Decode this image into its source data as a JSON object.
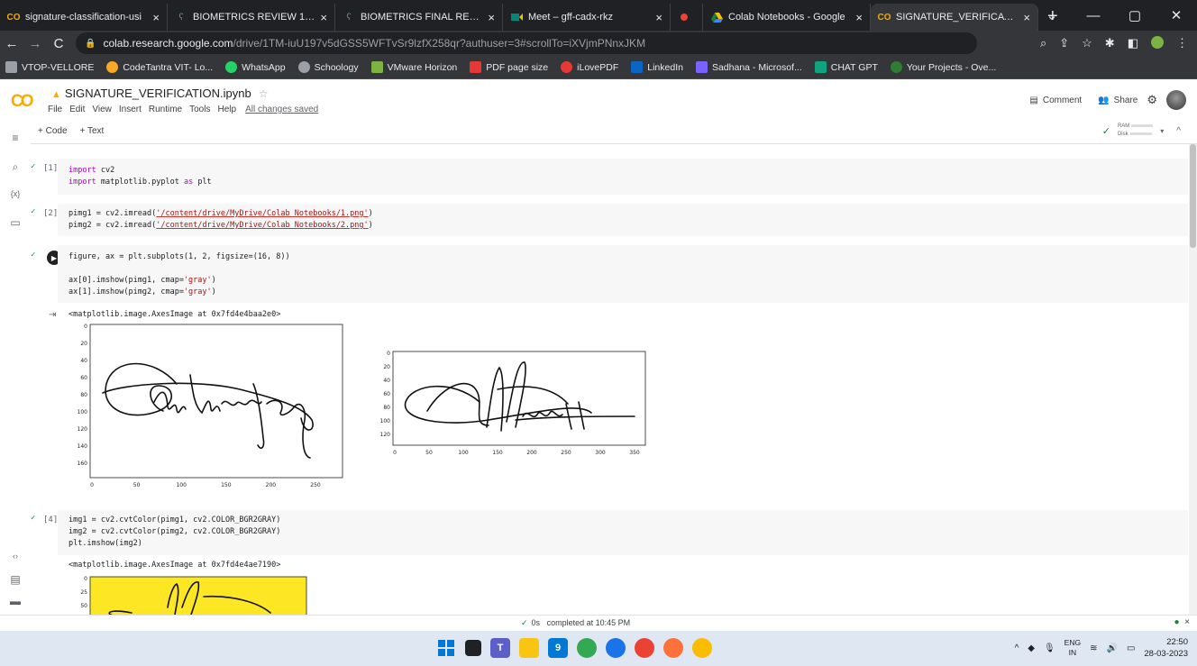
{
  "browser": {
    "tabs": [
      {
        "title": "signature-classification-usi",
        "icon": "colab-icon",
        "color": "#f9ab00"
      },
      {
        "title": "BIOMETRICS REVIEW 1 - O",
        "icon": "vtop-icon",
        "color": "#2e7d32"
      },
      {
        "title": "BIOMETRICS FINAL REVIEW",
        "icon": "vtop-icon",
        "color": "#2e7d32"
      },
      {
        "title": "Meet – gff-cadx-rkz",
        "icon": "meet-icon",
        "color": "#00897b"
      },
      {
        "title": "",
        "icon": "record-icon",
        "color": "#ea4335"
      },
      {
        "title": "Colab Notebooks - Google",
        "icon": "drive-icon",
        "color": "#fbbc04"
      },
      {
        "title": "SIGNATURE_VERIFICATION",
        "icon": "colab-icon",
        "color": "#f9ab00"
      }
    ],
    "close_glyph": "×",
    "new_tab": "+",
    "url_host": "colab.research.google.com",
    "url_path": "/drive/1TM-iuU197v5dGSS5WFTvSr9lzfX258qr?authuser=3#scrollTo=iXVjmPNnxJKM",
    "bookmarks": [
      {
        "label": "VTOP-VELLORE",
        "color": "#5f6368"
      },
      {
        "label": "CodeTantra VIT- Lo...",
        "color": "#f9a825"
      },
      {
        "label": "WhatsApp",
        "color": "#25d366"
      },
      {
        "label": "Schoology",
        "color": "#9aa0a6"
      },
      {
        "label": "VMware Horizon",
        "color": "#7cb342"
      },
      {
        "label": "PDF page size",
        "color": "#e53935"
      },
      {
        "label": "iLovePDF",
        "color": "#e53935"
      },
      {
        "label": "LinkedIn",
        "color": "#0a66c2"
      },
      {
        "label": "Sadhana - Microsof...",
        "color": "#7b61ff"
      },
      {
        "label": "CHAT GPT",
        "color": "#10a37f"
      },
      {
        "label": "Your Projects - Ove...",
        "color": "#2e7d32"
      }
    ]
  },
  "colab": {
    "logo": "CO",
    "notebook_title": "SIGNATURE_VERIFICATION.ipynb",
    "menu": [
      "File",
      "Edit",
      "View",
      "Insert",
      "Runtime",
      "Tools",
      "Help"
    ],
    "saved_status": "All changes saved",
    "comment_label": "Comment",
    "share_label": "Share",
    "add_code": "+ Code",
    "add_text": "+ Text",
    "ram_label": "RAM",
    "disk_label": "Disk"
  },
  "cells": {
    "c1": {
      "exec": "[1]",
      "line1": "import cv2",
      "line2": "import matplotlib.pyplot as plt"
    },
    "c2": {
      "exec": "[2]",
      "line1_pre": "pimg1 = cv2.imread(",
      "line1_str": "'/content/drive/MyDrive/Colab Notebooks/1.png'",
      "line1_post": ")",
      "line2_pre": "pimg2 = cv2.imread(",
      "line2_str": "'/content/drive/MyDrive/Colab Notebooks/2.png'",
      "line2_post": ")"
    },
    "c3": {
      "line1": "figure, ax = plt.subplots(1, 2, figsize=(16, 8))",
      "line2_pre": "ax[0].imshow(pimg1, cmap=",
      "line2_str": "'gray'",
      "line2_post": ")",
      "line3_pre": "ax[1].imshow(pimg2, cmap=",
      "line3_str": "'gray'",
      "line3_post": ")",
      "output": "<matplotlib.image.AxesImage at 0x7fd4e4baa2e0>"
    },
    "c4": {
      "exec": "[4]",
      "line1": "img1 = cv2.cvtColor(pimg1, cv2.COLOR_BGR2GRAY)",
      "line2": "img2 = cv2.cvtColor(pimg2, cv2.COLOR_BGR2GRAY)",
      "line3": "plt.imshow(img2)",
      "output": "<matplotlib.image.AxesImage at 0x7fd4e4ae7190>"
    }
  },
  "plots": {
    "plot1": {
      "yticks": [
        "0",
        "20",
        "40",
        "60",
        "80",
        "100",
        "120",
        "140",
        "160"
      ],
      "xticks": [
        "0",
        "50",
        "100",
        "150",
        "200",
        "250"
      ]
    },
    "plot2": {
      "yticks": [
        "0",
        "20",
        "40",
        "60",
        "80",
        "100",
        "120"
      ],
      "xticks": [
        "0",
        "50",
        "100",
        "150",
        "200",
        "250",
        "300",
        "350"
      ]
    },
    "plot3": {
      "yticks": [
        "0",
        "25",
        "50"
      ],
      "bg": "#fde725"
    }
  },
  "status": {
    "check": "✓",
    "time": "0s",
    "message": "completed at 10:45 PM"
  },
  "taskbar": {
    "lang1": "ENG",
    "lang2": "IN",
    "time": "22:50",
    "date": "28-03-2023"
  }
}
